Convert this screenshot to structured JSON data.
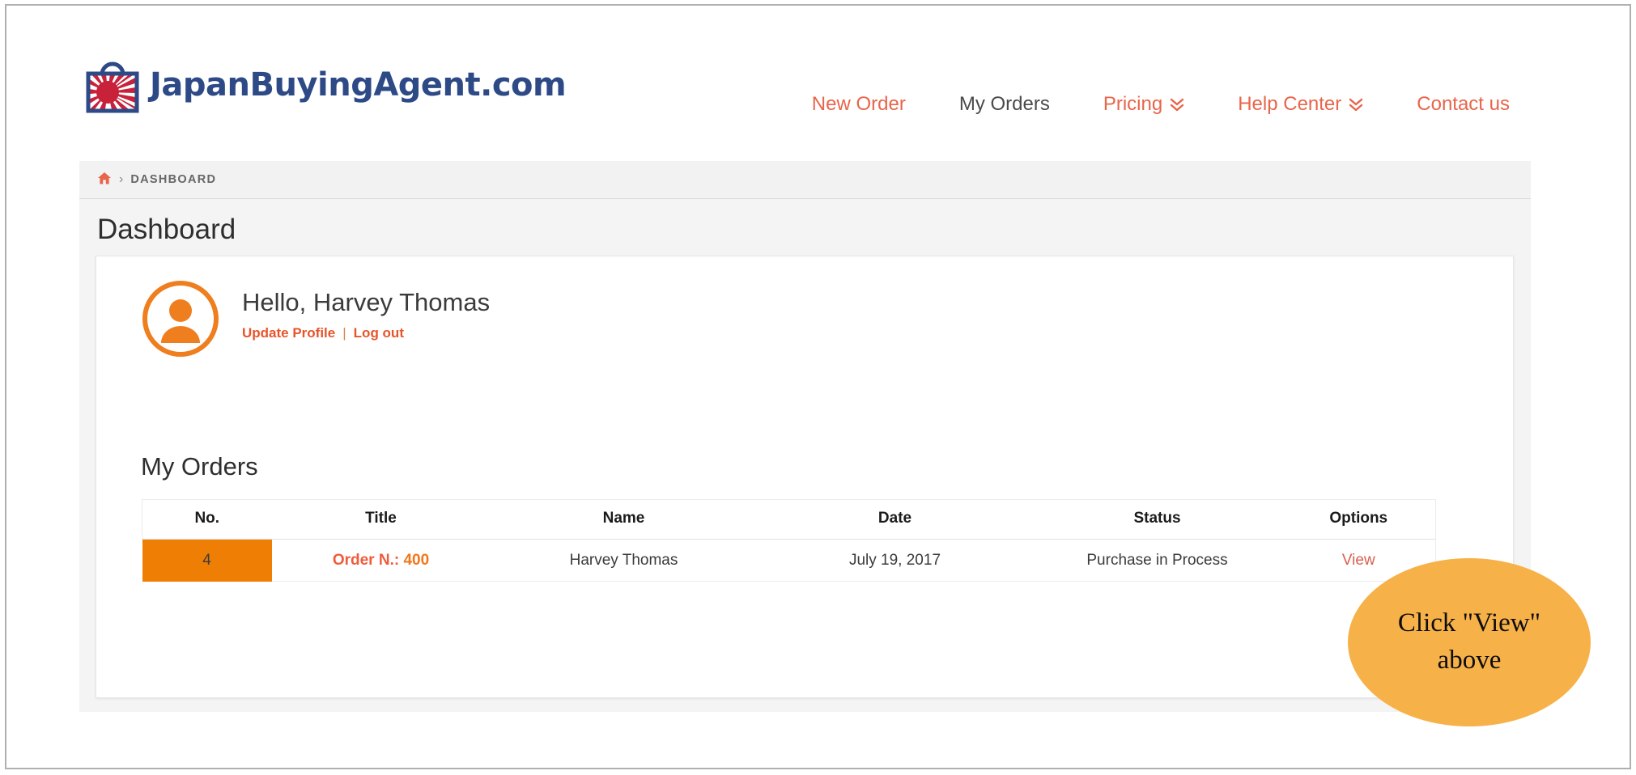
{
  "brand": {
    "name": "JapanBuyingAgent.com",
    "logo_icon": "shopping-bag-rising-sun-logo",
    "color": "#2d4a87"
  },
  "nav": {
    "items": [
      {
        "label": "New Order",
        "active": false,
        "has_caret": false
      },
      {
        "label": "My Orders",
        "active": true,
        "has_caret": false
      },
      {
        "label": "Pricing",
        "active": false,
        "has_caret": true
      },
      {
        "label": "Help Center",
        "active": false,
        "has_caret": true
      },
      {
        "label": "Contact us",
        "active": false,
        "has_caret": false
      }
    ],
    "link_color": "#e8654a",
    "active_color": "#4a4a4a",
    "caret_icon": "angle-double-down-icon"
  },
  "breadcrumb": {
    "home_icon": "home-icon",
    "separator": "›",
    "current": "DASHBOARD"
  },
  "page": {
    "title": "Dashboard"
  },
  "profile": {
    "avatar_icon": "user-avatar-icon",
    "greeting": "Hello, Harvey Thomas",
    "update_label": "Update Profile",
    "separator": "|",
    "logout_label": "Log out",
    "link_color": "#e8542a"
  },
  "orders": {
    "heading": "My Orders",
    "columns": [
      "No.",
      "Title",
      "Name",
      "Date",
      "Status",
      "Options"
    ],
    "rows": [
      {
        "no": "4",
        "title_label": "Order N.:",
        "title_number": "400",
        "name": "Harvey Thomas",
        "date": "July 19, 2017",
        "status": "Purchase in Process",
        "option_label": "View"
      }
    ],
    "no_cell_color": "#ef7e05",
    "view_link_color": "#d8604f"
  },
  "callout": {
    "text": "Click \"View\"\nabove",
    "background": "#f7b149",
    "text_color": "#0d0d0d"
  }
}
